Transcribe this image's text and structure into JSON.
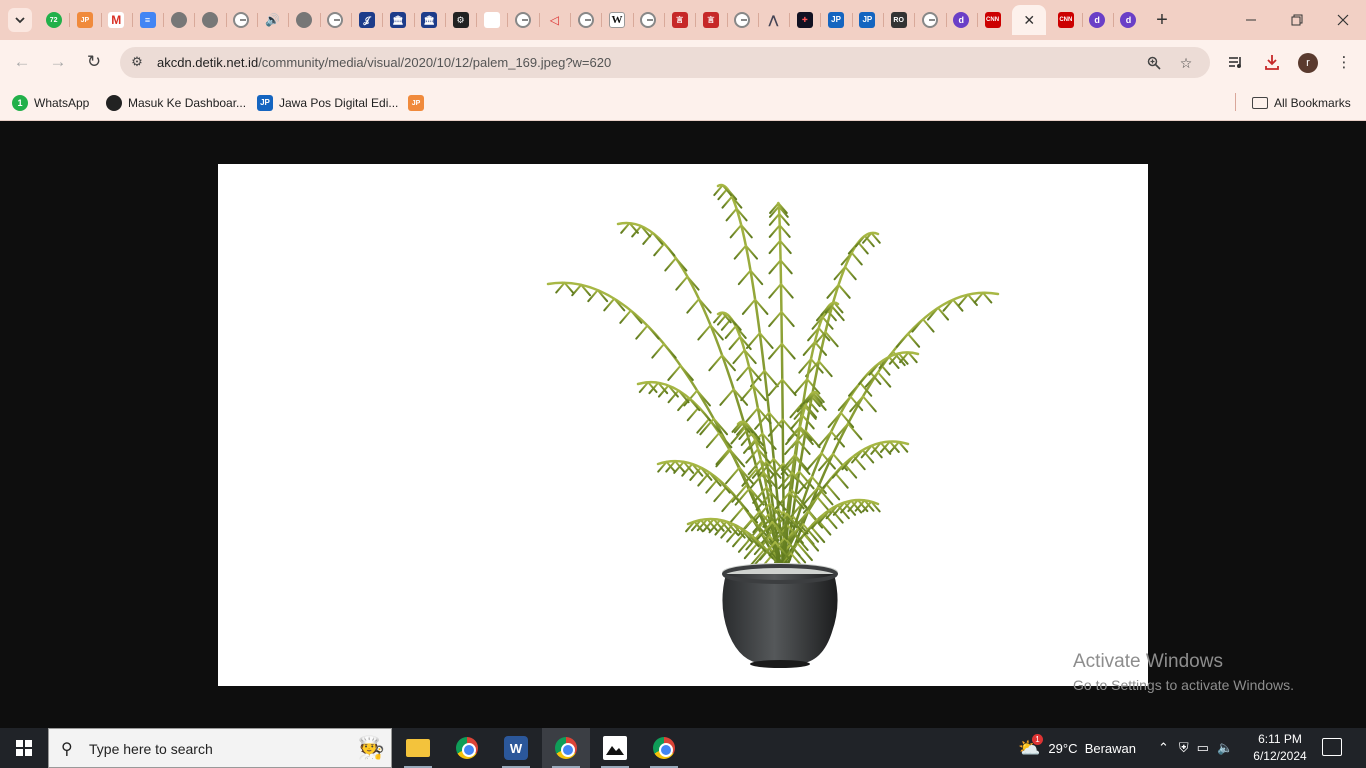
{
  "tabs": [
    {
      "icon": "green",
      "text": "72",
      "name": "whatsapp-icon"
    },
    {
      "icon": "orange",
      "text": "JP",
      "name": "jawapos-icon"
    },
    {
      "icon": "gm",
      "text": "M",
      "name": "gmail-icon"
    },
    {
      "icon": "doc",
      "text": "≡",
      "name": "docs-icon"
    },
    {
      "icon": "globe",
      "text": "",
      "name": "globe-icon"
    },
    {
      "icon": "globe",
      "text": "",
      "name": "globe-icon"
    },
    {
      "icon": "g",
      "text": "",
      "name": "google-icon"
    },
    {
      "icon": "spk",
      "text": "🔊",
      "name": "speaker-icon"
    },
    {
      "icon": "globe",
      "text": "",
      "name": "globe-icon"
    },
    {
      "icon": "g",
      "text": "",
      "name": "google-icon"
    },
    {
      "icon": "navy",
      "text": "𝒥",
      "name": "journal-icon"
    },
    {
      "icon": "navy",
      "text": "🏛",
      "name": "university-icon"
    },
    {
      "icon": "navy",
      "text": "🏛",
      "name": "university-icon"
    },
    {
      "icon": "blk",
      "text": "⚙",
      "name": "emblem-icon"
    },
    {
      "icon": "white",
      "text": "",
      "name": "blank-page-icon"
    },
    {
      "icon": "g",
      "text": "",
      "name": "google-icon"
    },
    {
      "icon": "arr",
      "text": "◁",
      "name": "arrow-icon"
    },
    {
      "icon": "g",
      "text": "",
      "name": "google-icon"
    },
    {
      "icon": "w",
      "text": "W",
      "name": "wikipedia-icon"
    },
    {
      "icon": "g",
      "text": "",
      "name": "google-icon"
    },
    {
      "icon": "red",
      "text": "言",
      "name": "red-badge-icon"
    },
    {
      "icon": "red",
      "text": "言",
      "name": "red-badge-icon"
    },
    {
      "icon": "g",
      "text": "",
      "name": "google-icon"
    },
    {
      "icon": "ai",
      "text": "⋀",
      "name": "wave-icon"
    },
    {
      "icon": "dt",
      "text": "✚",
      "name": "news-icon"
    },
    {
      "icon": "jp",
      "text": "JP",
      "name": "jawapos-icon"
    },
    {
      "icon": "jp",
      "text": "JP",
      "name": "jawapos-icon"
    },
    {
      "icon": "ro",
      "text": "RO",
      "name": "ro-icon"
    },
    {
      "icon": "g",
      "text": "",
      "name": "google-icon"
    },
    {
      "icon": "d",
      "text": "d",
      "name": "detik-icon"
    },
    {
      "icon": "cnn",
      "text": "CNN",
      "name": "cnn-icon"
    },
    {
      "icon": "active",
      "text": "",
      "name": "active-tab"
    },
    {
      "icon": "cnn",
      "text": "CNN",
      "name": "cnn-icon"
    },
    {
      "icon": "d",
      "text": "d",
      "name": "detik-icon"
    },
    {
      "icon": "d",
      "text": "d",
      "name": "detik-icon"
    }
  ],
  "address": {
    "host": "akcdn.detik.net.id",
    "path": "/community/media/visual/2020/10/12/palem_169.jpeg?w=620"
  },
  "profile": {
    "initial": "r"
  },
  "bookmarks": [
    {
      "label": "WhatsApp"
    },
    {
      "label": "Masuk Ke Dashboar..."
    },
    {
      "label": "Jawa Pos Digital Edi..."
    }
  ],
  "all_bookmarks": "All Bookmarks",
  "watermark": {
    "title": "Activate Windows",
    "subtitle": "Go to Settings to activate Windows."
  },
  "taskbar": {
    "search_placeholder": "Type here to search",
    "weather": "29°C  Berawan",
    "weather_badge": "1",
    "time": "6:11 PM",
    "date": "6/12/2024"
  },
  "colors": {
    "tab_strip": "#f2d0c5",
    "toolbar": "#fdf1ec",
    "page_bg": "#0e0e0e"
  }
}
